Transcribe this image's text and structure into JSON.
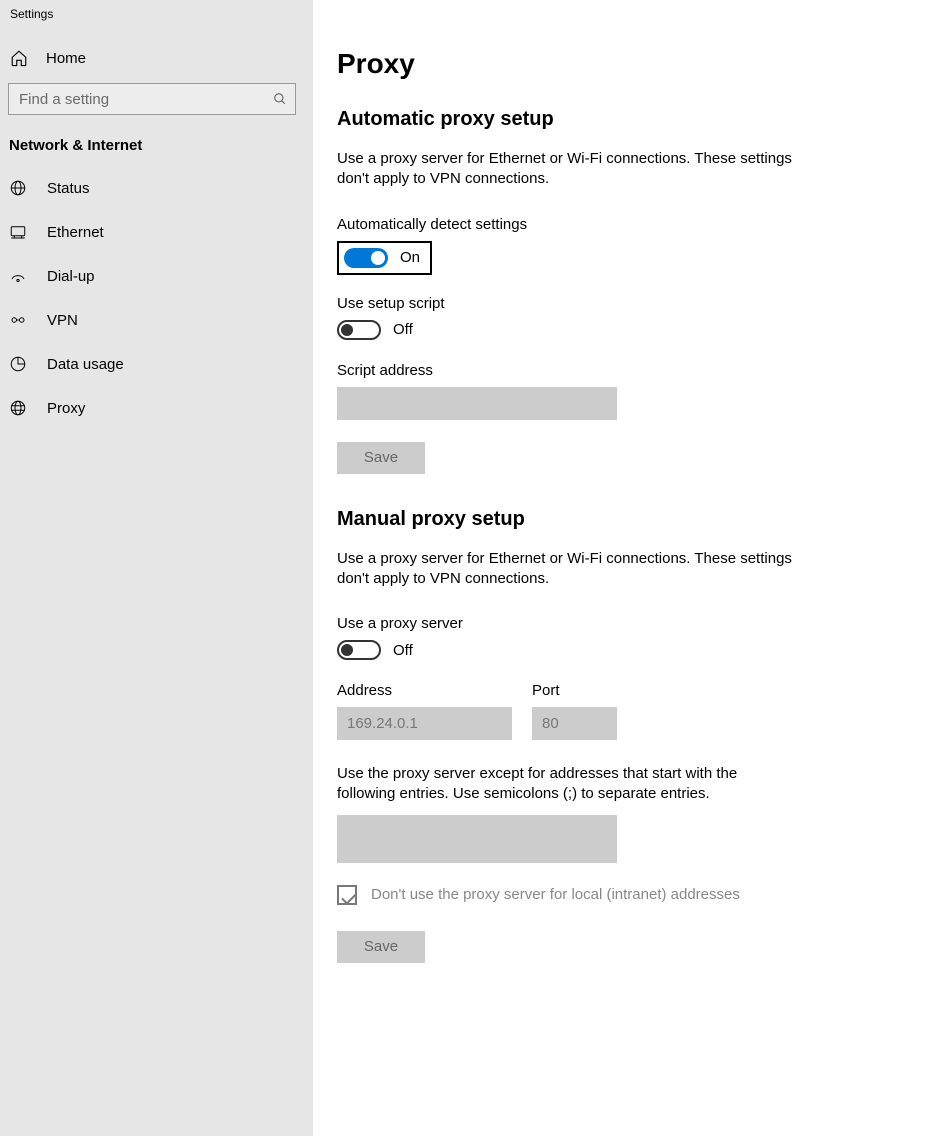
{
  "app_title": "Settings",
  "home_label": "Home",
  "search_placeholder": "Find a setting",
  "section_header": "Network & Internet",
  "nav": {
    "status": "Status",
    "ethernet": "Ethernet",
    "dialup": "Dial-up",
    "vpn": "VPN",
    "data_usage": "Data usage",
    "proxy": "Proxy"
  },
  "page_title": "Proxy",
  "auto": {
    "title": "Automatic proxy setup",
    "desc": "Use a proxy server for Ethernet or Wi-Fi connections. These settings don't apply to VPN connections.",
    "auto_detect_label": "Automatically detect settings",
    "auto_detect_state": "On",
    "use_script_label": "Use setup script",
    "use_script_state": "Off",
    "script_address_label": "Script address",
    "script_address_value": "",
    "save": "Save"
  },
  "manual": {
    "title": "Manual proxy setup",
    "desc": "Use a proxy server for Ethernet or Wi-Fi connections. These settings don't apply to VPN connections.",
    "use_proxy_label": "Use a proxy server",
    "use_proxy_state": "Off",
    "address_label": "Address",
    "address_value": "169.24.0.1",
    "port_label": "Port",
    "port_value": "80",
    "except_desc": "Use the proxy server except for addresses that start with the following entries. Use semicolons (;) to separate entries.",
    "except_value": "",
    "local_label": "Don't use the proxy server for local (intranet) addresses",
    "save": "Save"
  }
}
